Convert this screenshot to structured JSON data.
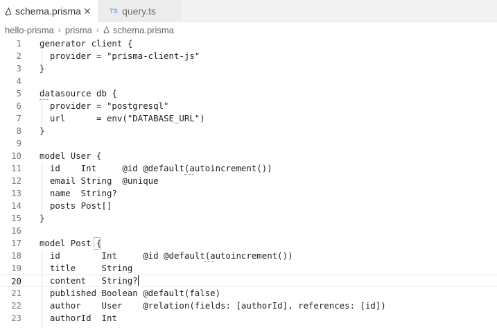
{
  "tabs": [
    {
      "label": "schema.prisma",
      "active": true
    },
    {
      "label": "query.ts",
      "badge": "TS",
      "active": false
    }
  ],
  "breadcrumb": {
    "items": [
      "hello-prisma",
      "prisma",
      "schema.prisma"
    ],
    "separator": "›"
  },
  "editor": {
    "current_line": 20,
    "lines": [
      {
        "n": "1",
        "text": "generator client {"
      },
      {
        "n": "2",
        "text": "  provider = \"prisma-client-js\""
      },
      {
        "n": "3",
        "text": "}"
      },
      {
        "n": "4",
        "text": ""
      },
      {
        "n": "5",
        "text": "datasource db {"
      },
      {
        "n": "6",
        "text": "  provider = \"postgresql\""
      },
      {
        "n": "7",
        "text": "  url      = env(\"DATABASE_URL\")"
      },
      {
        "n": "8",
        "text": "}"
      },
      {
        "n": "9",
        "text": ""
      },
      {
        "n": "10",
        "text": "model User {"
      },
      {
        "n": "11",
        "text": "  id    Int     @id @default(autoincrement())"
      },
      {
        "n": "12",
        "text": "  email String  @unique"
      },
      {
        "n": "13",
        "text": "  name  String?"
      },
      {
        "n": "14",
        "text": "  posts Post[]"
      },
      {
        "n": "15",
        "text": "}"
      },
      {
        "n": "16",
        "text": ""
      },
      {
        "n": "17",
        "text": "model Post {"
      },
      {
        "n": "18",
        "text": "  id        Int     @id @default(autoincrement())"
      },
      {
        "n": "19",
        "text": "  title     String"
      },
      {
        "n": "20",
        "text": "  content   String?"
      },
      {
        "n": "21",
        "text": "  published Boolean @default(false)"
      },
      {
        "n": "22",
        "text": "  author    User    @relation(fields: [authorId], references: [id])"
      },
      {
        "n": "23",
        "text": "  authorId  Int"
      }
    ]
  },
  "colors": {
    "tabbar_bg": "#f3f3f3",
    "active_tab_bg": "#ffffff",
    "prisma_icon": "#2d3748",
    "ts_badge": "#3178c6",
    "line_number": "#6e7681",
    "text": "#1f1f1f"
  },
  "icons": {
    "prisma_file": "prisma-file-icon",
    "close": "close-icon"
  }
}
